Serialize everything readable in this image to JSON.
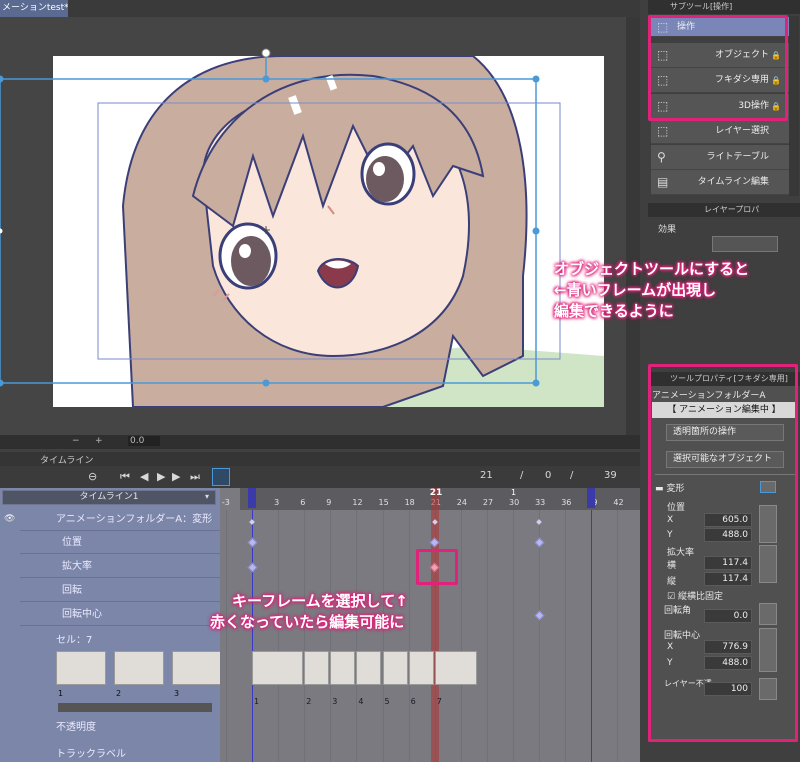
{
  "document": {
    "tab_label": "メーションtest*"
  },
  "status": {
    "zoom": "0.0",
    "plus": "+",
    "minus": "−"
  },
  "timeline": {
    "panel_title": "タイムライン",
    "selector_value": "タイムライン1",
    "counters": [
      "21",
      "/",
      "0",
      "/",
      "39"
    ],
    "ruler_ticks": [
      "-3",
      "0",
      "3",
      "6",
      "9",
      "12",
      "15",
      "18",
      "21",
      "24",
      "27",
      "30",
      "33",
      "36",
      "39",
      "42"
    ],
    "current_frame": "21",
    "marker_1": "1",
    "rows": {
      "folder": "アニメーションフォルダーA：変形",
      "position": "位置",
      "scale": "拡大率",
      "rotation": "回転",
      "rotation_center": "回転中心",
      "cell": "セル：7",
      "opacity": "不透明度",
      "track_label": "トラックラベル"
    },
    "cell_numbers_left": [
      "1",
      "2",
      "3"
    ],
    "cell_numbers_right": [
      "1",
      "2",
      "3",
      "4",
      "5",
      "6",
      "7"
    ],
    "keyframes": [
      {
        "row": 0,
        "frame": 0,
        "size": "small"
      },
      {
        "row": 0,
        "frame": 21,
        "size": "small"
      },
      {
        "row": 0,
        "frame": 33,
        "size": "small"
      },
      {
        "row": 1,
        "frame": 0,
        "size": "big"
      },
      {
        "row": 1,
        "frame": 21,
        "size": "big"
      },
      {
        "row": 1,
        "frame": 33,
        "size": "big"
      },
      {
        "row": 2,
        "frame": 0,
        "size": "big"
      },
      {
        "row": 2,
        "frame": 21,
        "size": "big",
        "selected": true
      },
      {
        "row": 4,
        "frame": 33,
        "size": "big"
      }
    ]
  },
  "subtool": {
    "panel_title": "サブツール[操作]",
    "items": [
      {
        "label": "操作",
        "icon": "operation-icon",
        "active": true
      },
      {
        "label": "オブジェクト",
        "icon": "object-icon",
        "lock": true
      },
      {
        "label": "フキダシ専用",
        "icon": "balloon-icon",
        "lock": true
      },
      {
        "label": "3D操作",
        "icon": "3d-icon",
        "lock": true
      },
      {
        "label": "レイヤー選択",
        "icon": "layer-select-icon"
      },
      {
        "label": "ライトテーブル",
        "icon": "lighttable-icon"
      },
      {
        "label": "タイムライン編集",
        "icon": "timeline-edit-icon"
      }
    ],
    "lock_glyph": "🔒"
  },
  "layer_property": {
    "tab_label": "レイヤープロパ",
    "effect_label": "効果"
  },
  "tool_property": {
    "panel_title": "ツールプロパティ[フキダシ専用]",
    "object_name": "アニメーションフォルダーA",
    "editing_badge": "【 アニメーション編集中 】",
    "dropdown_1": "透明箇所の操作",
    "dropdown_2": "選択可能なオブジェクト",
    "section_transform": "変形",
    "position_label": "位置",
    "x_label": "X",
    "y_label": "Y",
    "pos_x": "605.0",
    "pos_y": "488.0",
    "scale_label": "拡大率",
    "scale_w_label": "横",
    "scale_h_label": "縦",
    "scale_w": "117.4",
    "scale_h": "117.4",
    "keep_ratio": "縦横比固定",
    "rotation_label": "回転角",
    "rotation_value": "0.0",
    "center_label": "回転中心",
    "center_x": "776.9",
    "center_y": "488.0",
    "layer_opacity_label": "レイヤー不透",
    "layer_opacity": "100"
  },
  "annotations": {
    "right_1": "オブジェクトツールにすると",
    "right_2": "←青いフレームが出現し",
    "right_3": "編集できるように",
    "bottom_1": "キーフレームを選択して↑",
    "bottom_2": "赤くなっていたら編集可能に"
  },
  "colors": {
    "accent_pink": "#e0227a",
    "frame_blue": "#4a9ad8",
    "current_frame_red": "#b83a3a"
  }
}
